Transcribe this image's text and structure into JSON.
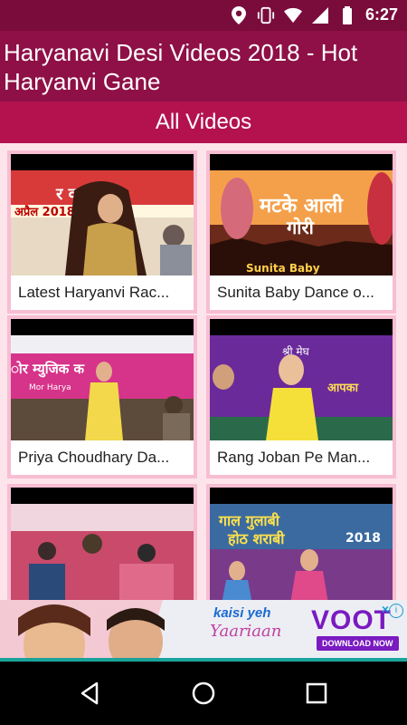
{
  "status_bar": {
    "time": "6:27",
    "icons": [
      "location-icon",
      "vibrate-icon",
      "wifi-icon",
      "signal-icon",
      "battery-icon"
    ]
  },
  "app_bar": {
    "title": "Haryanavi Desi Videos 2018 - Hot Haryanvi Gane"
  },
  "section": {
    "label": "All Videos"
  },
  "videos": [
    {
      "title": "Latest Haryanvi Rac..."
    },
    {
      "title": "Sunita Baby Dance o..."
    },
    {
      "title": "Priya Choudhary Da..."
    },
    {
      "title": "Rang Joban Pe Man..."
    },
    {
      "title": ""
    },
    {
      "title": ""
    }
  ],
  "ad": {
    "text_1": "kaisi yeh",
    "text_2": "Yaariaan",
    "brand": "VOOT",
    "cta": "DOWNLOAD NOW"
  },
  "colors": {
    "status_bar": "#7a0c3c",
    "app_bar": "#8e1046",
    "section_bar": "#b3124f",
    "card_border": "#f7bed3",
    "grid_bg": "#fde4ea"
  }
}
